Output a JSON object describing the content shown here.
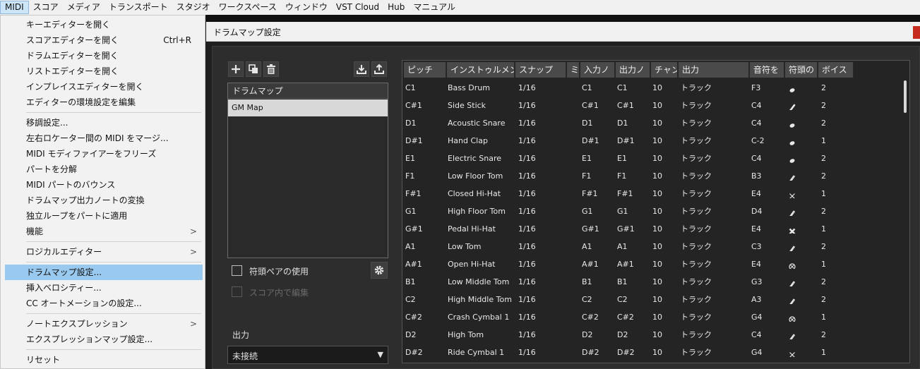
{
  "menubar": {
    "items": [
      "MIDI",
      "スコア",
      "メディア",
      "トランスポート",
      "スタジオ",
      "ワークスペース",
      "ウィンドウ",
      "VST Cloud",
      "Hub",
      "マニュアル"
    ]
  },
  "midi_menu": {
    "items": [
      {
        "label": "キーエディターを開く",
        "shortcut": ""
      },
      {
        "label": "スコアエディターを開く",
        "shortcut": "Ctrl+R"
      },
      {
        "label": "ドラムエディターを開く",
        "shortcut": ""
      },
      {
        "label": "リストエディターを開く",
        "shortcut": ""
      },
      {
        "label": "インプレイスエディターを開く",
        "shortcut": ""
      },
      {
        "label": "エディターの環境設定を編集",
        "shortcut": ""
      },
      {
        "label": "移調設定...",
        "shortcut": ""
      },
      {
        "label": "左右ロケーター間の MIDI をマージ...",
        "shortcut": ""
      },
      {
        "label": "MIDI モディファイアーをフリーズ",
        "shortcut": ""
      },
      {
        "label": "パートを分解",
        "shortcut": ""
      },
      {
        "label": "MIDI パートのバウンス",
        "shortcut": ""
      },
      {
        "label": "ドラムマップ出力ノートの変換",
        "shortcut": ""
      },
      {
        "label": "独立ループをパートに適用",
        "shortcut": ""
      },
      {
        "label": "機能",
        "shortcut": ""
      },
      {
        "label": "ロジカルエディター",
        "shortcut": ""
      },
      {
        "label": "ドラムマップ設定...",
        "shortcut": ""
      },
      {
        "label": "挿入ベロシティー...",
        "shortcut": ""
      },
      {
        "label": "CC オートメーションの設定...",
        "shortcut": ""
      },
      {
        "label": "ノートエクスプレッション",
        "shortcut": ""
      },
      {
        "label": "エクスプレッションマップ設定...",
        "shortcut": ""
      },
      {
        "label": "リセット",
        "shortcut": ""
      }
    ],
    "selected": "ドラムマップ設定..."
  },
  "dialog": {
    "title": "ドラムマップ設定",
    "map_list_header": "ドラムマップ",
    "map_list_item": "GM Map",
    "use_head_pairs_label": "符頭ペアの使用",
    "edit_in_score_label": "スコア内で編集",
    "output_label": "出力",
    "output_value": "未接続"
  },
  "table": {
    "columns": [
      "ピッチ",
      "インストゥルメント",
      "スナップ",
      "ミ",
      "入力ノ",
      "出力ノ",
      "チャン",
      "出力",
      "音符を",
      "符頭の",
      "ボイス"
    ],
    "rows": [
      {
        "pitch": "C1",
        "instrument": "Bass Drum",
        "snap": "1/16",
        "input": "C1",
        "output_note": "C1",
        "channel": "10",
        "output": "トラック",
        "display": "F3",
        "head": "filled",
        "voice": "2"
      },
      {
        "pitch": "C#1",
        "instrument": "Side Stick",
        "snap": "1/16",
        "input": "C#1",
        "output_note": "C#1",
        "channel": "10",
        "output": "トラック",
        "display": "C4",
        "head": "slash",
        "voice": "2"
      },
      {
        "pitch": "D1",
        "instrument": "Acoustic Snare",
        "snap": "1/16",
        "input": "D1",
        "output_note": "D1",
        "channel": "10",
        "output": "トラック",
        "display": "C4",
        "head": "filled",
        "voice": "2"
      },
      {
        "pitch": "D#1",
        "instrument": "Hand Clap",
        "snap": "1/16",
        "input": "D#1",
        "output_note": "D#1",
        "channel": "10",
        "output": "トラック",
        "display": "C-2",
        "head": "filled",
        "voice": "1"
      },
      {
        "pitch": "E1",
        "instrument": "Electric Snare",
        "snap": "1/16",
        "input": "E1",
        "output_note": "E1",
        "channel": "10",
        "output": "トラック",
        "display": "C4",
        "head": "filled",
        "voice": "2"
      },
      {
        "pitch": "F1",
        "instrument": "Low Floor Tom",
        "snap": "1/16",
        "input": "F1",
        "output_note": "F1",
        "channel": "10",
        "output": "トラック",
        "display": "B3",
        "head": "slash-open",
        "voice": "2"
      },
      {
        "pitch": "F#1",
        "instrument": "Closed Hi-Hat",
        "snap": "1/16",
        "input": "F#1",
        "output_note": "F#1",
        "channel": "10",
        "output": "トラック",
        "display": "E4",
        "head": "cross",
        "voice": "1"
      },
      {
        "pitch": "G1",
        "instrument": "High Floor Tom",
        "snap": "1/16",
        "input": "G1",
        "output_note": "G1",
        "channel": "10",
        "output": "トラック",
        "display": "D4",
        "head": "slash-open",
        "voice": "2"
      },
      {
        "pitch": "G#1",
        "instrument": "Pedal Hi-Hat",
        "snap": "1/16",
        "input": "G#1",
        "output_note": "G#1",
        "channel": "10",
        "output": "トラック",
        "display": "E4",
        "head": "cross-bold",
        "voice": "1"
      },
      {
        "pitch": "A1",
        "instrument": "Low Tom",
        "snap": "1/16",
        "input": "A1",
        "output_note": "A1",
        "channel": "10",
        "output": "トラック",
        "display": "C3",
        "head": "slash-open",
        "voice": "2"
      },
      {
        "pitch": "A#1",
        "instrument": "Open Hi-Hat",
        "snap": "1/16",
        "input": "A#1",
        "output_note": "A#1",
        "channel": "10",
        "output": "トラック",
        "display": "E4",
        "head": "circle-cross",
        "voice": "1"
      },
      {
        "pitch": "B1",
        "instrument": "Low Middle Tom",
        "snap": "1/16",
        "input": "B1",
        "output_note": "B1",
        "channel": "10",
        "output": "トラック",
        "display": "G3",
        "head": "slash-open",
        "voice": "2"
      },
      {
        "pitch": "C2",
        "instrument": "High Middle Tom",
        "snap": "1/16",
        "input": "C2",
        "output_note": "C2",
        "channel": "10",
        "output": "トラック",
        "display": "A3",
        "head": "slash-open",
        "voice": "2"
      },
      {
        "pitch": "C#2",
        "instrument": "Crash Cymbal 1",
        "snap": "1/16",
        "input": "C#2",
        "output_note": "C#2",
        "channel": "10",
        "output": "トラック",
        "display": "G4",
        "head": "circle-cross",
        "voice": "1"
      },
      {
        "pitch": "D2",
        "instrument": "High Tom",
        "snap": "1/16",
        "input": "D2",
        "output_note": "D2",
        "channel": "10",
        "output": "トラック",
        "display": "C4",
        "head": "slash-open",
        "voice": "2"
      },
      {
        "pitch": "D#2",
        "instrument": "Ride Cymbal 1",
        "snap": "1/16",
        "input": "D#2",
        "output_note": "D#2",
        "channel": "10",
        "output": "トラック",
        "display": "G4",
        "head": "cross",
        "voice": "1"
      }
    ]
  },
  "colors": {
    "menu_selected": "#99c9ef",
    "dialog_bg": "#2d2d2d",
    "table_header": "#4a4a4a"
  }
}
